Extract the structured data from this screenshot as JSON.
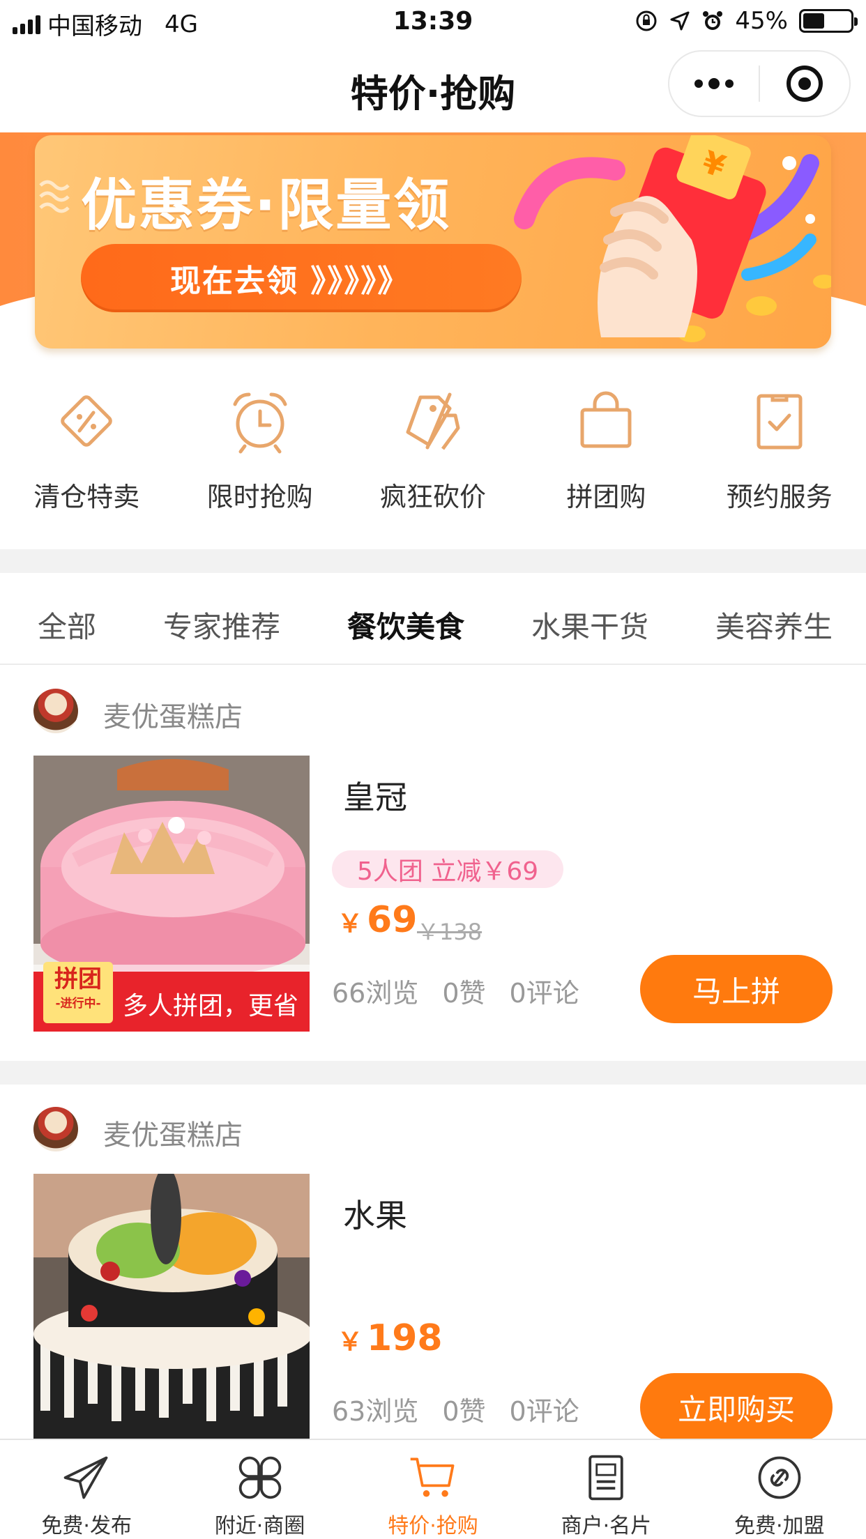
{
  "status_bar": {
    "carrier": "中国移动",
    "network": "4G",
    "time": "13:39",
    "battery": "45%",
    "battery_level": 0.45
  },
  "navbar": {
    "title": "特价·抢购",
    "menu_icon": "more-dots-icon",
    "close_icon": "target-icon"
  },
  "banner": {
    "headline": "优惠券·限量领",
    "cta": "现在去领 》》》》》"
  },
  "categories": [
    {
      "label": "清仓特卖",
      "icon": "discount-tag-icon"
    },
    {
      "label": "限时抢购",
      "icon": "alarm-clock-icon"
    },
    {
      "label": "疯狂砍价",
      "icon": "price-cut-icon"
    },
    {
      "label": "拼团购",
      "icon": "shopping-bag-icon"
    },
    {
      "label": "预约服务",
      "icon": "checklist-icon"
    }
  ],
  "tabs": [
    "全部",
    "专家推荐",
    "餐饮美食",
    "水果干货",
    "美容养生"
  ],
  "active_tab": "餐饮美食",
  "products": [
    {
      "shop": "麦优蛋糕店",
      "name": "皇冠",
      "tag": "5人团 立减￥69",
      "currency": "￥",
      "price": "69",
      "old_price": "￥138",
      "views": "66浏览",
      "likes": "0赞",
      "comments": "0评论",
      "button": "马上拼",
      "badge_main": "拼团",
      "badge_sub": "-进行中-",
      "badge_text": "多人拼团，更省"
    },
    {
      "shop": "麦优蛋糕店",
      "name": "水果",
      "currency": "￥",
      "price": "198",
      "views": "63浏览",
      "likes": "0赞",
      "comments": "0评论",
      "button": "立即购买"
    }
  ],
  "tabbar": [
    {
      "label": "免费·发布",
      "icon": "paper-plane-icon"
    },
    {
      "label": "附近·商圈",
      "icon": "four-leaf-icon"
    },
    {
      "label": "特价·抢购",
      "icon": "shopping-cart-icon"
    },
    {
      "label": "商户·名片",
      "icon": "business-card-icon"
    },
    {
      "label": "免费·加盟",
      "icon": "link-icon"
    }
  ],
  "colors": {
    "accent": "#ff7a1a",
    "tag_pink": "#f0628e",
    "badge_red": "#e8232b"
  }
}
